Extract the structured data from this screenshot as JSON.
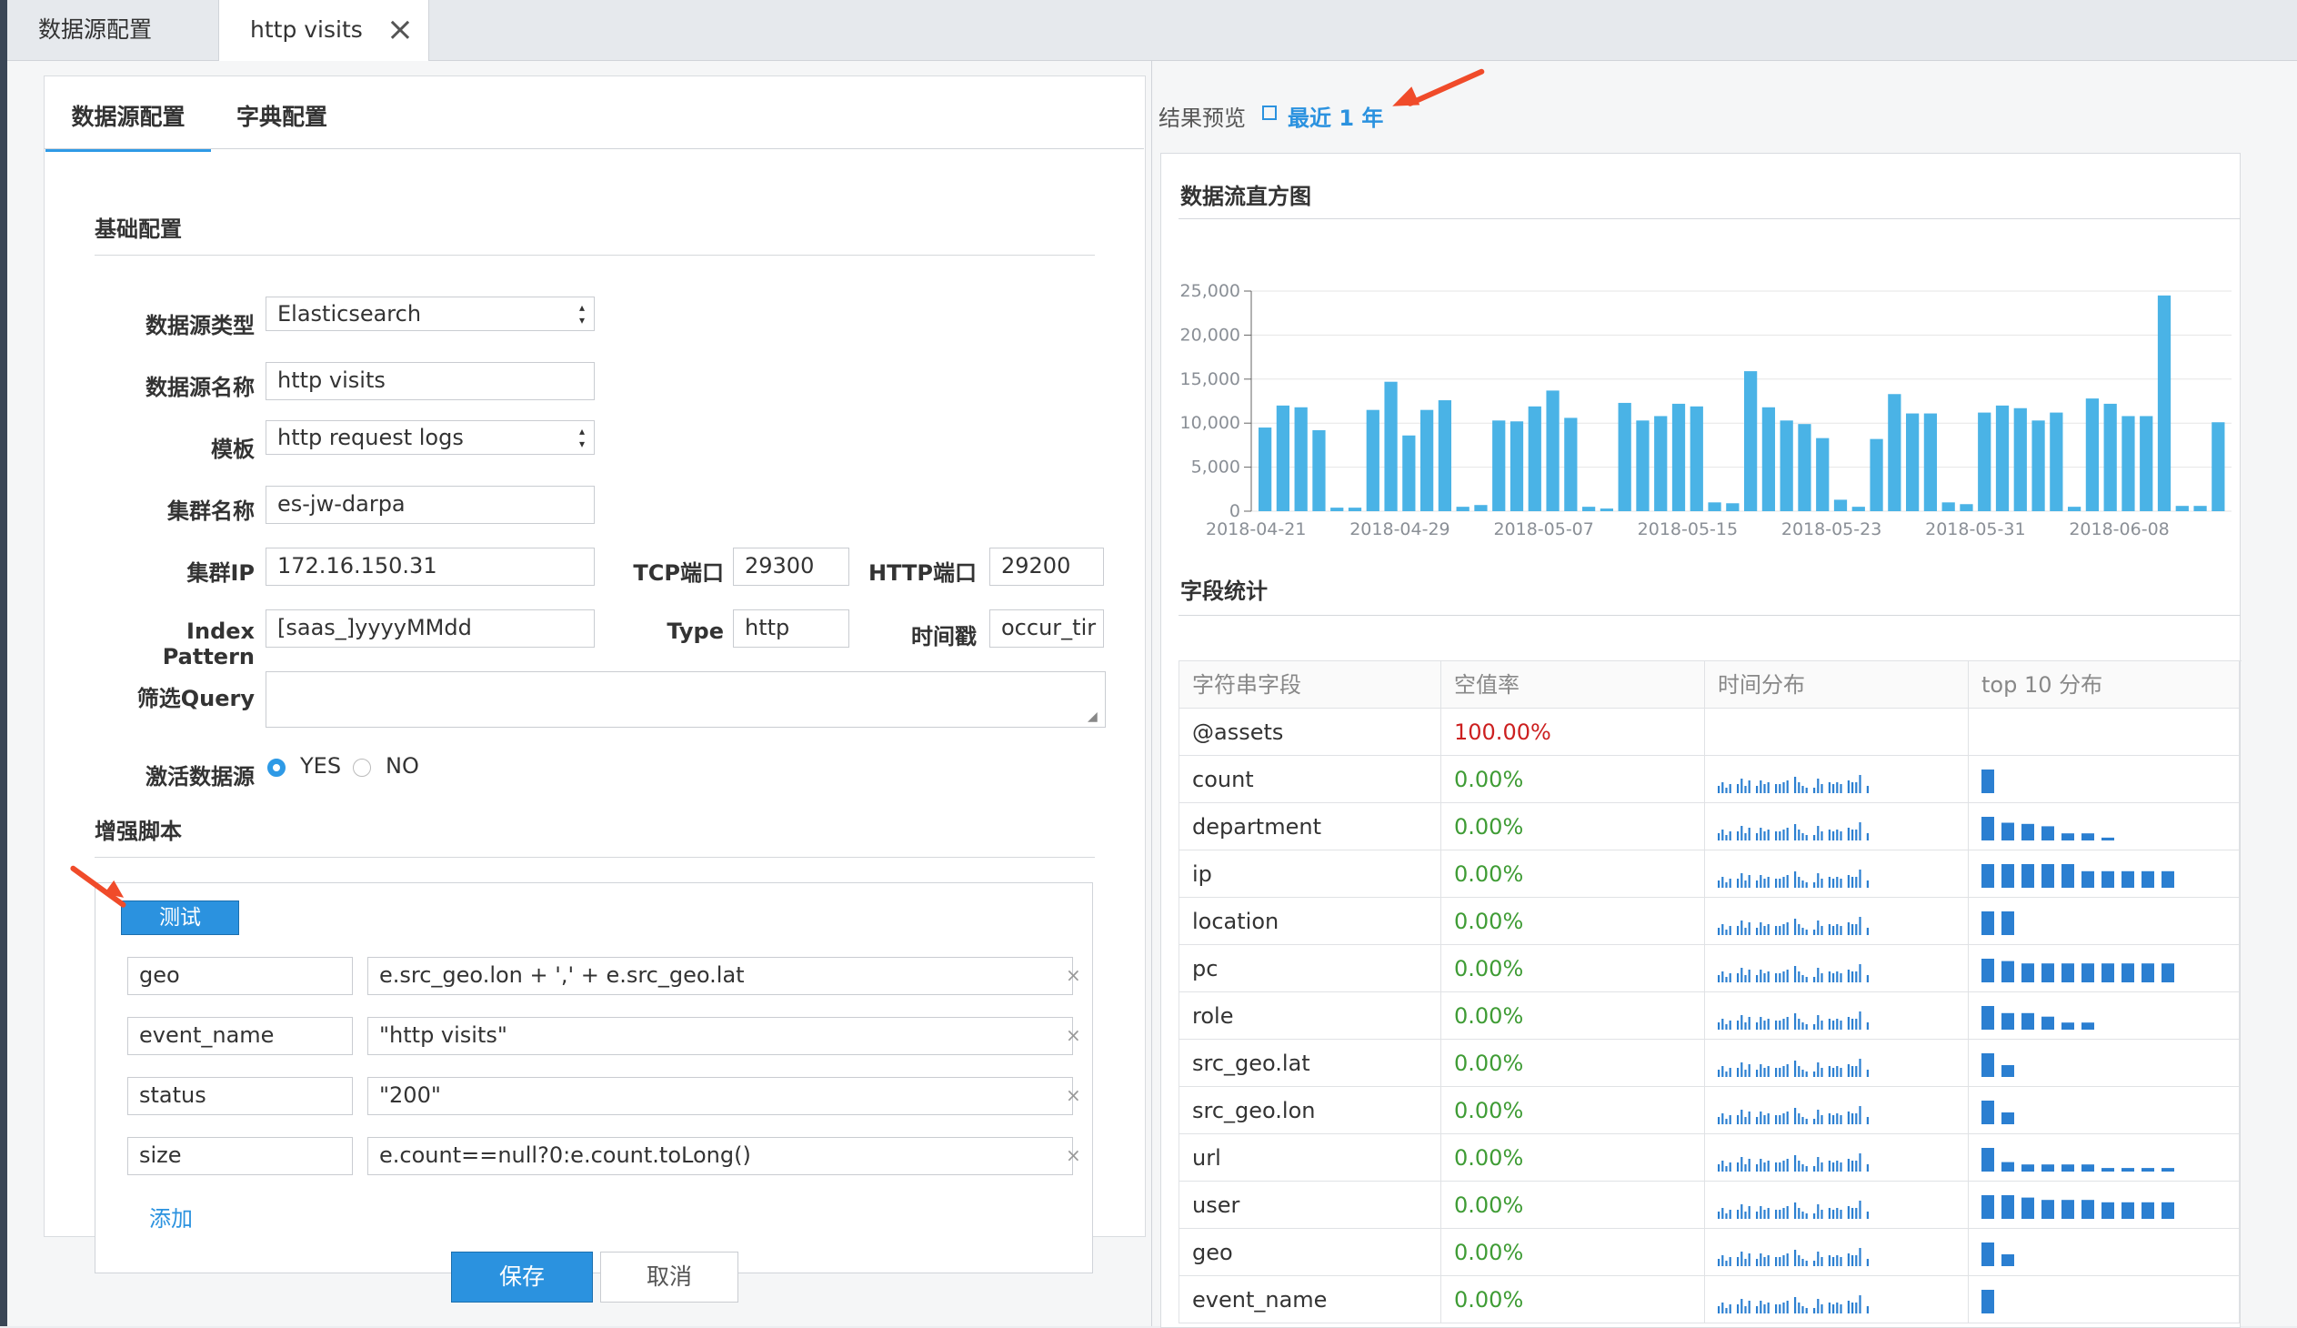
{
  "tabs": [
    {
      "label": "数据源配置"
    },
    {
      "label": "http visits"
    }
  ],
  "tab_close": "×",
  "subtabs": [
    "数据源配置",
    "字典配置"
  ],
  "basic": {
    "title": "基础配置",
    "ds_type_label": "数据源类型",
    "ds_type_value": "Elasticsearch",
    "ds_name_label": "数据源名称",
    "ds_name_value": "http visits",
    "template_label": "模板",
    "template_value": "http request logs",
    "cluster_name_label": "集群名称",
    "cluster_name_value": "es-jw-darpa",
    "cluster_ip_label": "集群IP",
    "cluster_ip_value": "172.16.150.31",
    "tcp_label": "TCP端口",
    "tcp_value": "29300",
    "http_label": "HTTP端口",
    "http_value": "29200",
    "index_label": "Index Pattern",
    "index_value": "[saas_]yyyyMMdd",
    "type_label": "Type",
    "type_value": "http",
    "ts_label": "时间戳",
    "ts_value": "occur_tir",
    "query_label": "筛选Query",
    "query_value": "",
    "active_label": "激活数据源",
    "yes": "YES",
    "no": "NO"
  },
  "script": {
    "title": "增强脚本",
    "test_button": "测试",
    "rows": [
      {
        "key": "geo",
        "value": "e.src_geo.lon + ',' + e.src_geo.lat"
      },
      {
        "key": "event_name",
        "value": "\"http visits\""
      },
      {
        "key": "status",
        "value": "\"200\""
      },
      {
        "key": "size",
        "value": "e.count==null?0:e.count.toLong()"
      }
    ],
    "remove_icon": "×",
    "add_link": "添加"
  },
  "actions": {
    "save": "保存",
    "cancel": "取消"
  },
  "preview": {
    "label": "结果预览",
    "range": "最近 1 年",
    "chart_title": "数据流直方图",
    "field_title": "字段统计",
    "accent_color": "#2b92df"
  },
  "chart_data": {
    "type": "bar",
    "title": "数据流直方图",
    "ylim": [
      0,
      25000
    ],
    "y_ticks": [
      "0",
      "5,000",
      "10,000",
      "15,000",
      "20,000",
      "25,000"
    ],
    "x_tick_labels": [
      "2018-04-21",
      "2018-04-29",
      "2018-05-07",
      "2018-05-15",
      "2018-05-23",
      "2018-05-31",
      "2018-06-08"
    ],
    "values": [
      9500,
      12000,
      11800,
      9200,
      400,
      400,
      11500,
      14700,
      8600,
      11500,
      12600,
      500,
      700,
      10300,
      10200,
      11900,
      13700,
      10600,
      500,
      300,
      12300,
      10300,
      10800,
      12200,
      11900,
      1000,
      900,
      15900,
      11800,
      10300,
      9900,
      8300,
      1300,
      500,
      8200,
      13300,
      11100,
      11100,
      1000,
      800,
      11200,
      12000,
      11700,
      10300,
      11200,
      500,
      12800,
      12200,
      10800,
      10800,
      24500,
      600,
      600,
      10100
    ],
    "color": "#4ab3e6"
  },
  "field_table": {
    "headers": [
      "字符串字段",
      "空值率",
      "时间分布",
      "top 10 分布"
    ],
    "rows": [
      {
        "field": "@assets",
        "null_rate": "100.00%",
        "top": []
      },
      {
        "field": "count",
        "null_rate": "0.00%",
        "top": [
          1
        ]
      },
      {
        "field": "department",
        "null_rate": "0.00%",
        "top": [
          1,
          0.75,
          0.7,
          0.6,
          0.3,
          0.3,
          0.12
        ]
      },
      {
        "field": "ip",
        "null_rate": "0.00%",
        "top": [
          1,
          1,
          1,
          1,
          1,
          0.7,
          0.7,
          0.7,
          0.7,
          0.7
        ]
      },
      {
        "field": "location",
        "null_rate": "0.00%",
        "top": [
          1,
          1
        ]
      },
      {
        "field": "pc",
        "null_rate": "0.00%",
        "top": [
          1,
          0.9,
          0.8,
          0.8,
          0.8,
          0.8,
          0.8,
          0.8,
          0.8,
          0.8
        ]
      },
      {
        "field": "role",
        "null_rate": "0.00%",
        "top": [
          1,
          0.7,
          0.7,
          0.55,
          0.3,
          0.3
        ]
      },
      {
        "field": "src_geo.lat",
        "null_rate": "0.00%",
        "top": [
          1,
          0.5
        ]
      },
      {
        "field": "src_geo.lon",
        "null_rate": "0.00%",
        "top": [
          1,
          0.5
        ]
      },
      {
        "field": "url",
        "null_rate": "0.00%",
        "top": [
          1,
          0.4,
          0.3,
          0.3,
          0.3,
          0.3,
          0.15,
          0.15,
          0.15,
          0.15
        ]
      },
      {
        "field": "user",
        "null_rate": "0.00%",
        "top": [
          1,
          1,
          0.9,
          0.8,
          0.8,
          0.8,
          0.7,
          0.7,
          0.7,
          0.7
        ]
      },
      {
        "field": "geo",
        "null_rate": "0.00%",
        "top": [
          1,
          0.5
        ]
      },
      {
        "field": "event_name",
        "null_rate": "0.00%",
        "top": [
          1
        ]
      }
    ],
    "null_rate_colors": {
      "full": "#cc1f1f",
      "zero": "#3f9c35"
    },
    "spark_color": "#2b7fd1"
  }
}
